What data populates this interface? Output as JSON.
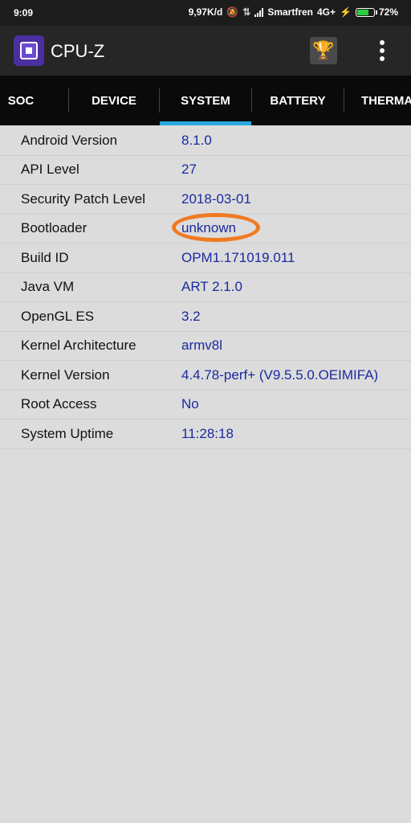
{
  "status_bar": {
    "time": "9:09",
    "network_speed": "9,97K/d",
    "carrier": "Smartfren",
    "network_type": "4G+",
    "battery_percent": "72%",
    "battery_level": 0.72
  },
  "app": {
    "title": "CPU-Z"
  },
  "tabs": [
    {
      "label": "SOC"
    },
    {
      "label": "DEVICE"
    },
    {
      "label": "SYSTEM"
    },
    {
      "label": "BATTERY"
    },
    {
      "label": "THERMA"
    }
  ],
  "active_tab": "SYSTEM",
  "rows": [
    {
      "label": "Android Version",
      "value": "8.1.0"
    },
    {
      "label": "API Level",
      "value": "27"
    },
    {
      "label": "Security Patch Level",
      "value": "2018-03-01"
    },
    {
      "label": "Bootloader",
      "value": "unknown"
    },
    {
      "label": "Build ID",
      "value": "OPM1.171019.011"
    },
    {
      "label": "Java VM",
      "value": "ART 2.1.0"
    },
    {
      "label": "OpenGL ES",
      "value": "3.2"
    },
    {
      "label": "Kernel Architecture",
      "value": "armv8l"
    },
    {
      "label": "Kernel Version",
      "value": "4.4.78-perf+ (V9.5.5.0.OEIMIFA)"
    },
    {
      "label": "Root Access",
      "value": "No"
    },
    {
      "label": "System Uptime",
      "value": "11:28:18"
    }
  ],
  "colors": {
    "accent": "#29a8e0",
    "value_text": "#1a2aa0",
    "highlight_circle": "#f07a22",
    "battery": "#2ecc40"
  }
}
